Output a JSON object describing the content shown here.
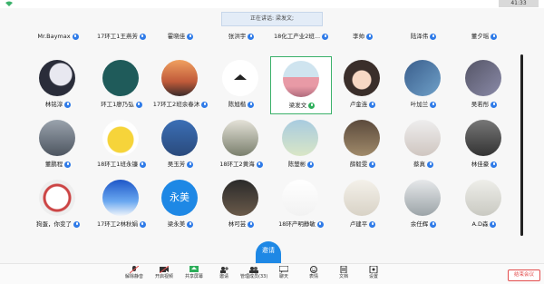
{
  "status_bar": {
    "time": "41:33"
  },
  "speaking_banner": "正在讲话: 梁发文;",
  "top_row": [
    {
      "name": "Mr.Baymax"
    },
    {
      "name": "17环工1王燕芳"
    },
    {
      "name": "霍晓佳"
    },
    {
      "name": "张洪宇"
    },
    {
      "name": "18化工产业2班..."
    },
    {
      "name": "李帅"
    },
    {
      "name": "陆泽伟"
    },
    {
      "name": "董夕瑶"
    }
  ],
  "participants": [
    {
      "name": "林铭淳",
      "avatar": "moon-photo"
    },
    {
      "name": "环工1廖乃弘",
      "avatar": "illustration-green"
    },
    {
      "name": "17环工2班余春沐",
      "avatar": "sunset-photo"
    },
    {
      "name": "陈旭楷",
      "avatar": "graduation-cap"
    },
    {
      "name": "梁发文",
      "avatar": "pink-landscape",
      "speaking": true
    },
    {
      "name": "卢金连",
      "avatar": "cartoon-girl"
    },
    {
      "name": "叶加兰",
      "avatar": "blue-art"
    },
    {
      "name": "吴若彤",
      "avatar": "anime-character"
    },
    {
      "name": "董鹏程",
      "avatar": "grey-photo"
    },
    {
      "name": "18环工1班永镰",
      "avatar": "pikachu"
    },
    {
      "name": "吴玉芳",
      "avatar": "cartoon-blue"
    },
    {
      "name": "18环工2黄海",
      "avatar": "outdoor-photo"
    },
    {
      "name": "陈楚彬",
      "avatar": "sky-photo"
    },
    {
      "name": "薛毅雯",
      "avatar": "field-photo"
    },
    {
      "name": "蔡真",
      "avatar": "portrait-girl"
    },
    {
      "name": "林佳豪",
      "avatar": "bw-photo"
    },
    {
      "name": "狗蛋，你变了",
      "avatar": "white-dog"
    },
    {
      "name": "17环工2林秋娟",
      "avatar": "blue-sky"
    },
    {
      "name": "梁永美",
      "avatar": "text-avatar",
      "text": "永美"
    },
    {
      "name": "林可芸",
      "avatar": "dark-photo"
    },
    {
      "name": "18环产明静敏",
      "avatar": "white-card"
    },
    {
      "name": "卢建平",
      "avatar": "sketch"
    },
    {
      "name": "余任辉",
      "avatar": "tree-photo"
    },
    {
      "name": "A.D森",
      "avatar": "drawing"
    }
  ],
  "bottom_tab": "邀请",
  "toolbar": [
    {
      "label": "解除静音",
      "icon": "mic-off-icon"
    },
    {
      "label": "开启视频",
      "icon": "camera-off-icon"
    },
    {
      "label": "共享屏幕",
      "icon": "screen-share-icon"
    },
    {
      "label": "邀请",
      "icon": "invite-icon"
    },
    {
      "label": "管理成员(33)",
      "icon": "members-icon"
    },
    {
      "label": "聊天",
      "icon": "chat-icon"
    },
    {
      "label": "表情",
      "icon": "emoji-icon"
    },
    {
      "label": "文档",
      "icon": "document-icon"
    },
    {
      "label": "设置",
      "icon": "settings-icon"
    }
  ],
  "end_button": "结束会议",
  "colors": {
    "accent": "#2f7be8",
    "speaking": "#3bb16a",
    "danger": "#e34d4d"
  }
}
